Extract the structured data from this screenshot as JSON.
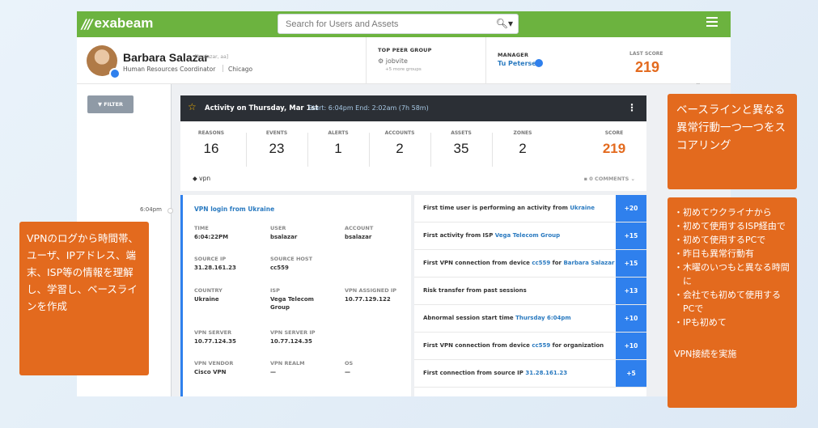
{
  "app": {
    "logo_mark": "///",
    "logo_text": "exabeam"
  },
  "search": {
    "placeholder": "Search for Users and Assets"
  },
  "profile": {
    "name": "Barbara Salazar",
    "handle": "[bsalazar, aa]",
    "role": "Human Resources Coordinator",
    "city": "Chicago",
    "peer_group_label": "TOP PEER GROUP",
    "peer_group_value": "jobvite",
    "peer_group_more": "+5 more groups",
    "manager_label": "MANAGER",
    "manager_value": "Tu Petersen",
    "last_score_label": "LAST SCORE",
    "last_score_value": "219"
  },
  "filter": {
    "label": "FILTER"
  },
  "timeline": {
    "time": "6:04pm"
  },
  "activity": {
    "title": "Activity on Thursday, Mar 1st",
    "times": "Start: 6:04pm End: 2:02am (7h 58m)"
  },
  "stats": [
    {
      "label": "REASONS",
      "value": "16"
    },
    {
      "label": "EVENTS",
      "value": "23"
    },
    {
      "label": "ALERTS",
      "value": "1"
    },
    {
      "label": "ACCOUNTS",
      "value": "2"
    },
    {
      "label": "ASSETS",
      "value": "35"
    },
    {
      "label": "ZONES",
      "value": "2"
    },
    {
      "label": "SCORE",
      "value": "219"
    }
  ],
  "tag": "vpn",
  "comments": "0 COMMENTS",
  "vpn": {
    "title": "VPN login from Ukraine",
    "fields": {
      "time": {
        "label": "TIME",
        "value": "6:04:22PM"
      },
      "user": {
        "label": "USER",
        "value": "bsalazar"
      },
      "account": {
        "label": "ACCOUNT",
        "value": "bsalazar"
      },
      "source_ip": {
        "label": "SOURCE IP",
        "value": "31.28.161.23"
      },
      "source_host": {
        "label": "SOURCE HOST",
        "value": "cc559"
      },
      "country": {
        "label": "COUNTRY",
        "value": "Ukraine"
      },
      "isp": {
        "label": "ISP",
        "value": "Vega Telecom Group"
      },
      "vpn_assigned_ip": {
        "label": "VPN ASSIGNED IP",
        "value": "10.77.129.122"
      },
      "vpn_server": {
        "label": "VPN SERVER",
        "value": "10.77.124.35"
      },
      "vpn_server_ip": {
        "label": "VPN SERVER IP",
        "value": "10.77.124.35"
      },
      "vpn_vendor": {
        "label": "VPN VENDOR",
        "value": "Cisco VPN"
      },
      "vpn_realm": {
        "label": "VPN REALM",
        "value": "—"
      },
      "os": {
        "label": "OS",
        "value": "—"
      }
    }
  },
  "reasons": [
    {
      "pre": "First time user is performing an activity from ",
      "hl": "Ukraine",
      "mid": "",
      "hl2": "",
      "score": "+20"
    },
    {
      "pre": "First activity from ISP ",
      "hl": "Vega Telecom Group",
      "mid": "",
      "hl2": "",
      "score": "+15"
    },
    {
      "pre": "First VPN connection from device ",
      "hl": "cc559",
      "mid": " for ",
      "hl2": "Barbara Salazar",
      "score": "+15"
    },
    {
      "pre": "Risk transfer from past sessions",
      "hl": "",
      "mid": "",
      "hl2": "",
      "score": "+13"
    },
    {
      "pre": "Abnormal session start time ",
      "hl": "Thursday 6:04pm",
      "mid": "",
      "hl2": "",
      "score": "+10"
    },
    {
      "pre": "First VPN connection from device ",
      "hl": "cc559",
      "mid": " for organization",
      "hl2": "",
      "score": "+10"
    },
    {
      "pre": "First connection from source IP ",
      "hl": "31.28.161.23",
      "mid": "",
      "hl2": "",
      "score": "+5"
    }
  ],
  "notes": {
    "left": "VPNのログから時間帯、ユーザ、IPアドレス、端末、ISP等の情報を理解し、学習し、ベースラインを作成",
    "top_right": "ベースラインと異なる異常行動一つ一つをスコアリング",
    "right_items": [
      "・初めてウクライナから",
      "・初めて使用するISP経由で",
      "・初めて使用するPCで",
      "・昨日も異常行動有",
      "・木曜のいつもと異なる時間に",
      "・会社でも初めて使用するPCで",
      "・IPも初めて"
    ],
    "right_footer": "VPN接続を実施"
  },
  "colors": {
    "brand_green": "#6cb33f",
    "accent_orange": "#e36a1e",
    "reason_blue": "#2f80ed"
  }
}
